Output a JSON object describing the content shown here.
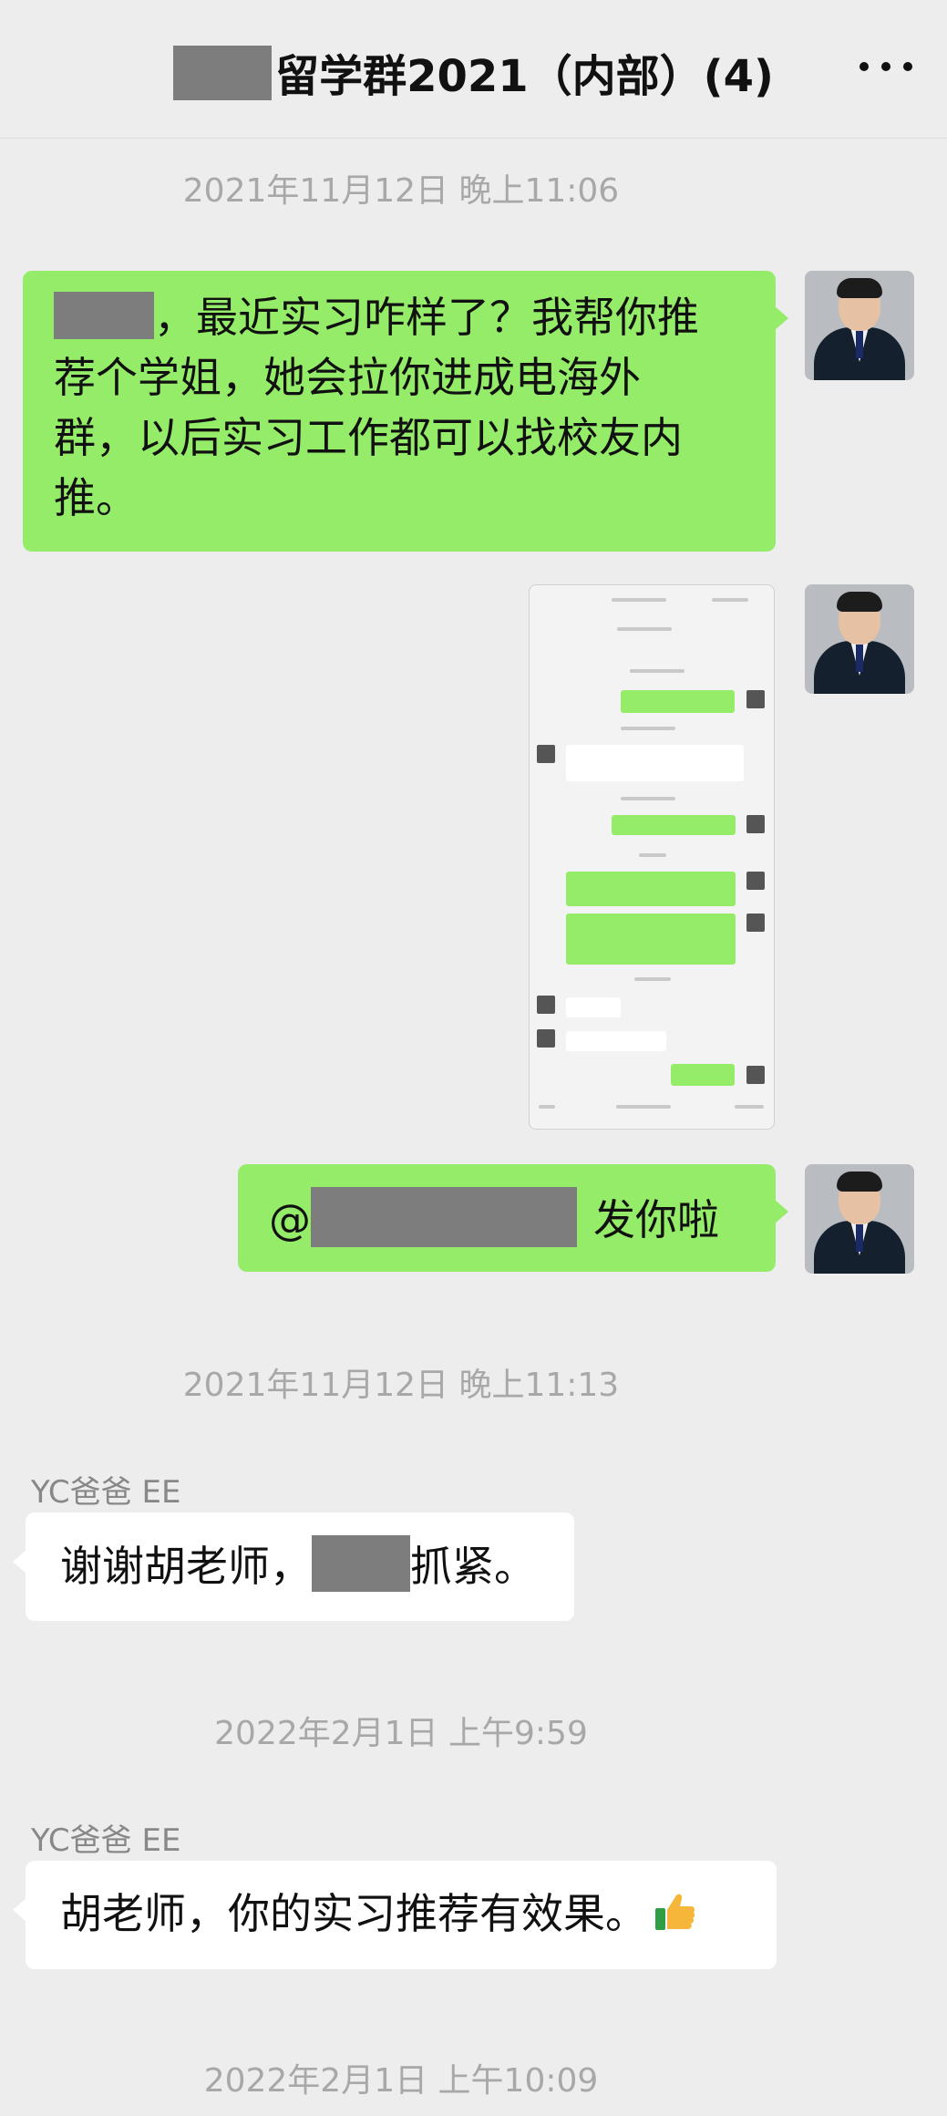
{
  "header": {
    "title": "留学群2021（内部）(4)",
    "more_icon": "more-horizontal-icon"
  },
  "messages": {
    "ts1": "2021年11月12日 晚上11:06",
    "msg1": "，最近实习咋样了？我帮你推荐个学姐，她会拉你进成电海外群，以后实习工作都可以找校友内推。",
    "msg1_line1": "，最近实习咋样了？我帮你推",
    "msg1_line2": "荐个学姐，她会拉你进成电海外",
    "msg1_line3": "群，以后实习工作都可以找校友内",
    "msg1_line4": "推。",
    "msg2_type": "image",
    "msg3_prefix": "@",
    "msg3_suffix": "发你啦",
    "ts2": "2021年11月12日 晚上11:13",
    "sender1": "YC爸爸 EE",
    "msg4_part1": "谢谢胡老师，",
    "msg4_part2": "抓紧。",
    "ts3": "2022年2月1日 上午9:59",
    "sender2": "YC爸爸 EE",
    "msg5": "胡老师，你的实习推荐有效果。",
    "msg5_icon": "thumbs-up-icon",
    "ts4": "2022年2月1日 上午10:09"
  },
  "colors": {
    "background": "#ededed",
    "bubble_self": "#95ec69",
    "bubble_other": "#ffffff",
    "timestamp": "#a8a8a8",
    "redaction": "#7d7d7d"
  }
}
